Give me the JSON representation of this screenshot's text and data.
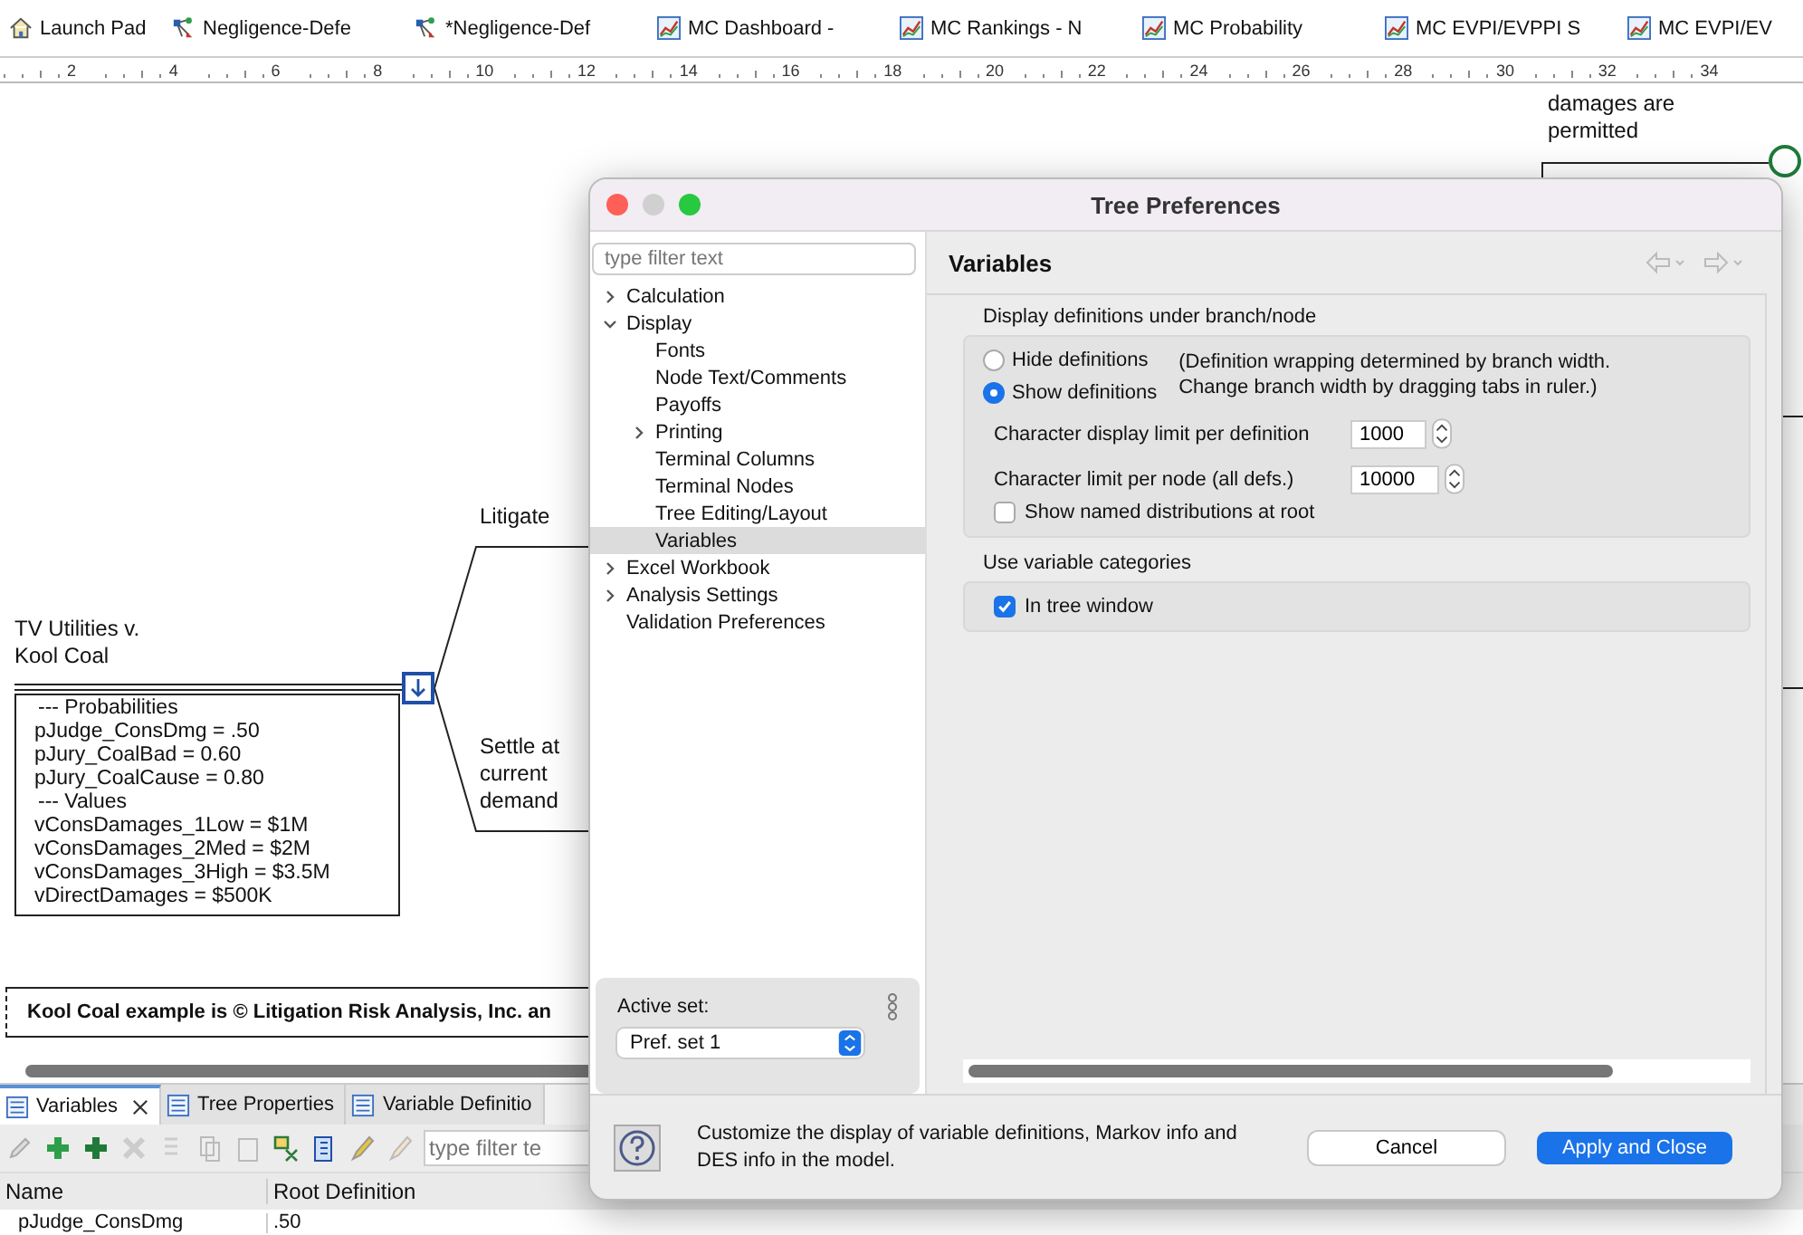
{
  "file_tabs": [
    {
      "label": "Launch Pad",
      "kind": "home"
    },
    {
      "label": "Negligence-Defe",
      "kind": "tree"
    },
    {
      "label": "*Negligence-Def",
      "kind": "tree"
    },
    {
      "label": "MC Dashboard -",
      "kind": "chart"
    },
    {
      "label": "MC Rankings - N",
      "kind": "chart"
    },
    {
      "label": "MC Probability",
      "kind": "chart"
    },
    {
      "label": "MC EVPI/EVPPI S",
      "kind": "chart"
    },
    {
      "label": "MC EVPI/EV",
      "kind": "chart"
    }
  ],
  "ruler": {
    "ticks": [
      "2",
      "4",
      "6",
      "8",
      "10",
      "12",
      "14",
      "16",
      "18",
      "20",
      "22",
      "24",
      "26",
      "28",
      "30",
      "32",
      "34"
    ]
  },
  "tree": {
    "upper_labels": [
      "damages are\npermitted"
    ],
    "root_title": "TV Utilities v.\nKool Coal",
    "definitions": [
      "--- Probabilities",
      "pJudge_ConsDmg = .50",
      "pJury_CoalBad = 0.60",
      "pJury_CoalCause = 0.80",
      "--- Values",
      "vConsDamages_1Low = $1M",
      "vConsDamages_2Med = $2M",
      "vConsDamages_3High = $3.5M",
      "vDirectDamages = $500K"
    ],
    "branches": [
      "Litigate",
      "Settle at\ncurrent\ndemand"
    ],
    "note": "Kool Coal example is © Litigation Risk Analysis, Inc. an"
  },
  "bottom_panel": {
    "tabs": [
      {
        "label": "Variables",
        "selected": true,
        "closable": true
      },
      {
        "label": "Tree Properties",
        "selected": false,
        "closable": false
      },
      {
        "label": "Variable Definitio",
        "selected": false,
        "closable": false
      }
    ],
    "filter": {
      "placeholder": "type filter te"
    },
    "columns": [
      "Name",
      "Root Definition"
    ],
    "row": [
      "pJudge_ConsDmg",
      ".50"
    ]
  },
  "dialog": {
    "title": "Tree Preferences",
    "filter": {
      "placeholder": "type filter text"
    },
    "nav": [
      {
        "label": "Calculation",
        "expanded": false,
        "selected": false
      },
      {
        "label": "Display",
        "expanded": true,
        "selected": false,
        "children": [
          {
            "label": "Fonts",
            "selected": false
          },
          {
            "label": "Node Text/Comments",
            "selected": false
          },
          {
            "label": "Payoffs",
            "selected": false
          },
          {
            "label": "Printing",
            "expanded": false,
            "selected": false
          },
          {
            "label": "Terminal Columns",
            "selected": false
          },
          {
            "label": "Terminal Nodes",
            "selected": false
          },
          {
            "label": "Tree Editing/Layout",
            "selected": false
          },
          {
            "label": "Variables",
            "selected": true
          }
        ]
      },
      {
        "label": "Excel Workbook",
        "expanded": false,
        "selected": false
      },
      {
        "label": "Analysis Settings",
        "expanded": false,
        "selected": false
      },
      {
        "label": "Validation Preferences",
        "selected": false
      }
    ],
    "active_set": {
      "label": "Active set:",
      "value": "Pref. set 1"
    },
    "page_title": "Variables",
    "group1": {
      "title": "Display definitions under branch/node",
      "radios": [
        {
          "label": "Hide definitions",
          "selected": false
        },
        {
          "label": "Show definitions",
          "selected": true
        }
      ],
      "note": "(Definition wrapping determined by branch width.\nChange branch width by dragging tabs in ruler.)",
      "spinners": [
        {
          "label": "Character display limit per definition",
          "value": "1000"
        },
        {
          "label": "Character limit per node (all defs.)",
          "value": "10000"
        }
      ],
      "checkbox": {
        "label": "Show named distributions at root",
        "checked": false
      }
    },
    "group2": {
      "title": "Use variable categories",
      "checkbox": {
        "label": "In tree window",
        "checked": true
      }
    },
    "help_text": "Customize the display of variable definitions, Markov info and DES info in the model.",
    "buttons": [
      {
        "label": "Cancel",
        "kind": "secondary"
      },
      {
        "label": "Apply and Close",
        "kind": "primary"
      }
    ]
  }
}
